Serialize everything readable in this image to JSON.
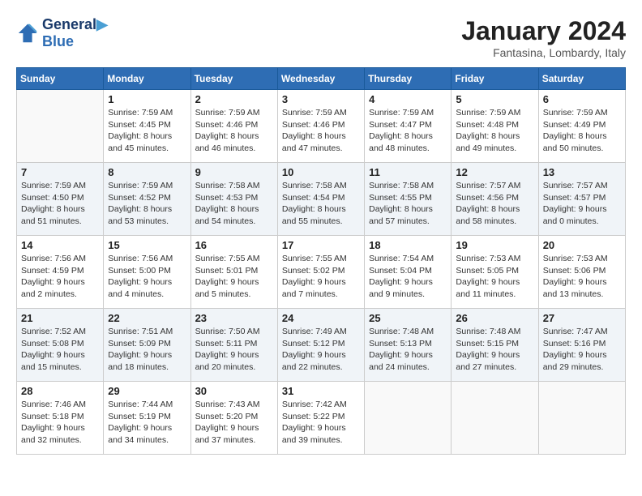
{
  "header": {
    "logo_line1": "General",
    "logo_line2": "Blue",
    "month_title": "January 2024",
    "location": "Fantasina, Lombardy, Italy"
  },
  "weekdays": [
    "Sunday",
    "Monday",
    "Tuesday",
    "Wednesday",
    "Thursday",
    "Friday",
    "Saturday"
  ],
  "weeks": [
    [
      {
        "day": "",
        "info": ""
      },
      {
        "day": "1",
        "info": "Sunrise: 7:59 AM\nSunset: 4:45 PM\nDaylight: 8 hours\nand 45 minutes."
      },
      {
        "day": "2",
        "info": "Sunrise: 7:59 AM\nSunset: 4:46 PM\nDaylight: 8 hours\nand 46 minutes."
      },
      {
        "day": "3",
        "info": "Sunrise: 7:59 AM\nSunset: 4:46 PM\nDaylight: 8 hours\nand 47 minutes."
      },
      {
        "day": "4",
        "info": "Sunrise: 7:59 AM\nSunset: 4:47 PM\nDaylight: 8 hours\nand 48 minutes."
      },
      {
        "day": "5",
        "info": "Sunrise: 7:59 AM\nSunset: 4:48 PM\nDaylight: 8 hours\nand 49 minutes."
      },
      {
        "day": "6",
        "info": "Sunrise: 7:59 AM\nSunset: 4:49 PM\nDaylight: 8 hours\nand 50 minutes."
      }
    ],
    [
      {
        "day": "7",
        "info": "Sunrise: 7:59 AM\nSunset: 4:50 PM\nDaylight: 8 hours\nand 51 minutes."
      },
      {
        "day": "8",
        "info": "Sunrise: 7:59 AM\nSunset: 4:52 PM\nDaylight: 8 hours\nand 53 minutes."
      },
      {
        "day": "9",
        "info": "Sunrise: 7:58 AM\nSunset: 4:53 PM\nDaylight: 8 hours\nand 54 minutes."
      },
      {
        "day": "10",
        "info": "Sunrise: 7:58 AM\nSunset: 4:54 PM\nDaylight: 8 hours\nand 55 minutes."
      },
      {
        "day": "11",
        "info": "Sunrise: 7:58 AM\nSunset: 4:55 PM\nDaylight: 8 hours\nand 57 minutes."
      },
      {
        "day": "12",
        "info": "Sunrise: 7:57 AM\nSunset: 4:56 PM\nDaylight: 8 hours\nand 58 minutes."
      },
      {
        "day": "13",
        "info": "Sunrise: 7:57 AM\nSunset: 4:57 PM\nDaylight: 9 hours\nand 0 minutes."
      }
    ],
    [
      {
        "day": "14",
        "info": "Sunrise: 7:56 AM\nSunset: 4:59 PM\nDaylight: 9 hours\nand 2 minutes."
      },
      {
        "day": "15",
        "info": "Sunrise: 7:56 AM\nSunset: 5:00 PM\nDaylight: 9 hours\nand 4 minutes."
      },
      {
        "day": "16",
        "info": "Sunrise: 7:55 AM\nSunset: 5:01 PM\nDaylight: 9 hours\nand 5 minutes."
      },
      {
        "day": "17",
        "info": "Sunrise: 7:55 AM\nSunset: 5:02 PM\nDaylight: 9 hours\nand 7 minutes."
      },
      {
        "day": "18",
        "info": "Sunrise: 7:54 AM\nSunset: 5:04 PM\nDaylight: 9 hours\nand 9 minutes."
      },
      {
        "day": "19",
        "info": "Sunrise: 7:53 AM\nSunset: 5:05 PM\nDaylight: 9 hours\nand 11 minutes."
      },
      {
        "day": "20",
        "info": "Sunrise: 7:53 AM\nSunset: 5:06 PM\nDaylight: 9 hours\nand 13 minutes."
      }
    ],
    [
      {
        "day": "21",
        "info": "Sunrise: 7:52 AM\nSunset: 5:08 PM\nDaylight: 9 hours\nand 15 minutes."
      },
      {
        "day": "22",
        "info": "Sunrise: 7:51 AM\nSunset: 5:09 PM\nDaylight: 9 hours\nand 18 minutes."
      },
      {
        "day": "23",
        "info": "Sunrise: 7:50 AM\nSunset: 5:11 PM\nDaylight: 9 hours\nand 20 minutes."
      },
      {
        "day": "24",
        "info": "Sunrise: 7:49 AM\nSunset: 5:12 PM\nDaylight: 9 hours\nand 22 minutes."
      },
      {
        "day": "25",
        "info": "Sunrise: 7:48 AM\nSunset: 5:13 PM\nDaylight: 9 hours\nand 24 minutes."
      },
      {
        "day": "26",
        "info": "Sunrise: 7:48 AM\nSunset: 5:15 PM\nDaylight: 9 hours\nand 27 minutes."
      },
      {
        "day": "27",
        "info": "Sunrise: 7:47 AM\nSunset: 5:16 PM\nDaylight: 9 hours\nand 29 minutes."
      }
    ],
    [
      {
        "day": "28",
        "info": "Sunrise: 7:46 AM\nSunset: 5:18 PM\nDaylight: 9 hours\nand 32 minutes."
      },
      {
        "day": "29",
        "info": "Sunrise: 7:44 AM\nSunset: 5:19 PM\nDaylight: 9 hours\nand 34 minutes."
      },
      {
        "day": "30",
        "info": "Sunrise: 7:43 AM\nSunset: 5:20 PM\nDaylight: 9 hours\nand 37 minutes."
      },
      {
        "day": "31",
        "info": "Sunrise: 7:42 AM\nSunset: 5:22 PM\nDaylight: 9 hours\nand 39 minutes."
      },
      {
        "day": "",
        "info": ""
      },
      {
        "day": "",
        "info": ""
      },
      {
        "day": "",
        "info": ""
      }
    ]
  ]
}
